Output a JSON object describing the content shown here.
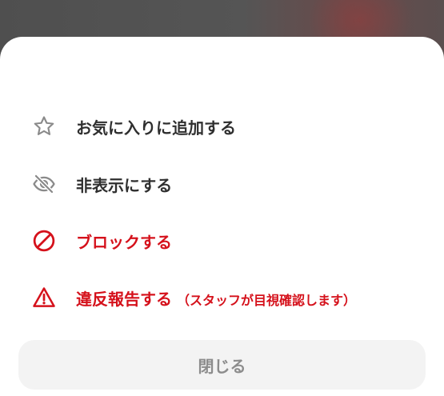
{
  "menu": {
    "favorite": {
      "label": "お気に入りに追加する",
      "icon": "star-icon"
    },
    "hide": {
      "label": "非表示にする",
      "icon": "eye-off-icon"
    },
    "block": {
      "label": "ブロックする",
      "icon": "block-icon"
    },
    "report": {
      "label": "違反報告する",
      "note": "（スタッフが目視確認します）",
      "icon": "warning-icon"
    }
  },
  "close_button": {
    "label": "閉じる"
  },
  "colors": {
    "danger": "#d5111b",
    "text": "#2f2f2f",
    "icon_gray": "#8a8a8a",
    "button_bg": "#f3f3f3",
    "button_text": "#8c8c8c"
  }
}
